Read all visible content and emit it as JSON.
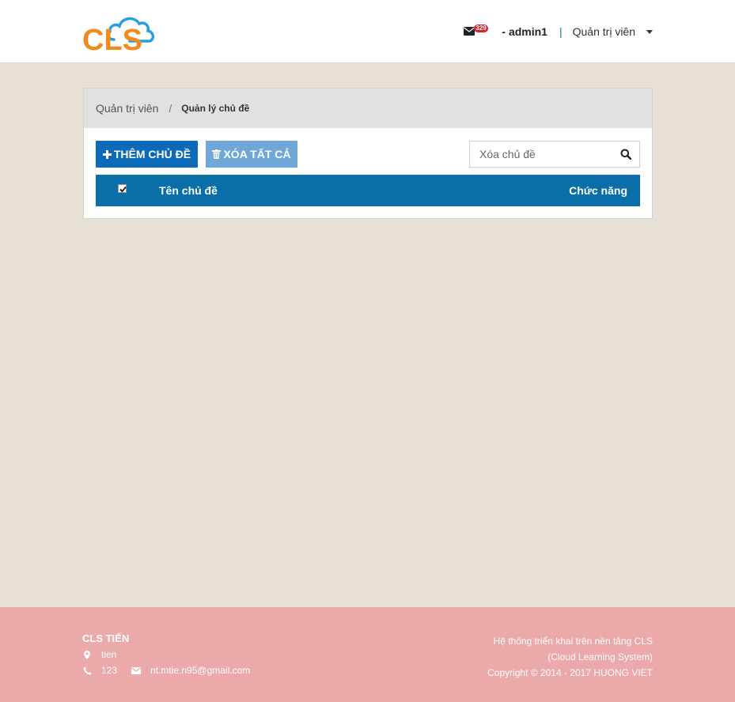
{
  "header": {
    "logo_text": "CLS",
    "mail_count": "329",
    "user": "- admin1",
    "separator": "|",
    "role": "Quản trị viên"
  },
  "breadcrumb": {
    "parent": "Quản trị viên",
    "separator": "/",
    "current": "Quản lý chủ đề"
  },
  "toolbar": {
    "add_label": "THÊM CHỦ ĐỀ",
    "delete_all_label": "XÓA TẤT CẢ"
  },
  "search": {
    "placeholder": "Xóa chủ đề"
  },
  "table": {
    "columns": [
      "Tên chủ đề",
      "Chức năng"
    ],
    "select_all_checked": true
  },
  "footer": {
    "brand": "CLS TIẾN",
    "address": "tien",
    "phone": "123",
    "email": "nt.mtie.n95@gmail.com",
    "right_line1": "Hệ thống triển khai trên nền tảng CLS",
    "right_line2": "(Cloud Learning System)",
    "right_line3": "Copyright © 2014 - 2017 HUONG VIET"
  },
  "colors": {
    "background": "#e7e0d4",
    "primary": "#0d6ab8",
    "table_header": "#0a6ea9",
    "footer": "#eba9a9",
    "logo_orange": "#f28a1c",
    "logo_blue": "#2a9de0"
  },
  "icons": [
    "envelope-icon",
    "caret-down-icon",
    "plus-icon",
    "trash-icon",
    "search-icon",
    "checkbox-icon",
    "map-marker-icon",
    "phone-icon"
  ]
}
